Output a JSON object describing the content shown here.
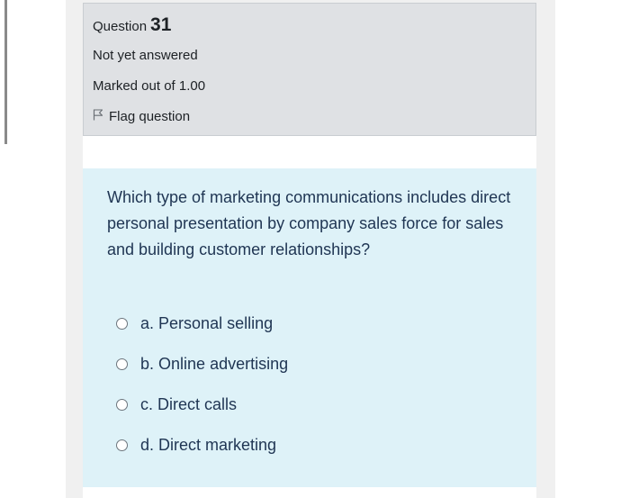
{
  "question": {
    "label": "Question",
    "number": "31",
    "state": "Not yet answered",
    "grade": "Marked out of 1.00",
    "flag_label": "Flag question"
  },
  "content": {
    "text": "Which type of marketing communications includes direct personal presentation by company sales force for sales and building customer relationships?",
    "options": [
      {
        "letter": "a.",
        "label": "Personal selling"
      },
      {
        "letter": "b.",
        "label": "Online advertising"
      },
      {
        "letter": "c.",
        "label": "Direct calls"
      },
      {
        "letter": "d.",
        "label": "Direct marketing"
      }
    ]
  },
  "icons": {
    "flag": "flag-icon",
    "radio": "radio-icon"
  }
}
